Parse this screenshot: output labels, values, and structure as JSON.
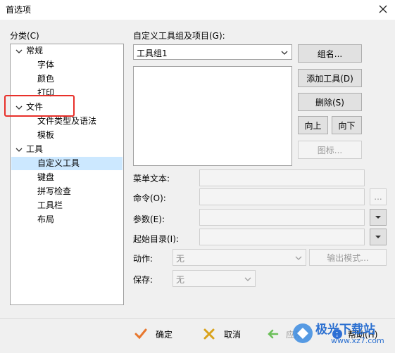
{
  "window": {
    "title": "首选项"
  },
  "category": {
    "label": "分类(C)",
    "items": [
      {
        "label": "常规"
      },
      {
        "label": "字体"
      },
      {
        "label": "颜色"
      },
      {
        "label": "打印"
      },
      {
        "label": "文件"
      },
      {
        "label": "文件类型及语法"
      },
      {
        "label": "模板"
      },
      {
        "label": "工具"
      },
      {
        "label": "自定义工具"
      },
      {
        "label": "键盘"
      },
      {
        "label": "拼写检查"
      },
      {
        "label": "工具栏"
      },
      {
        "label": "布局"
      }
    ]
  },
  "tools": {
    "group_label": "自定义工具组及项目(G):",
    "group_value": "工具组1",
    "buttons": {
      "group_name": "组名...",
      "add_tool": "添加工具(D)",
      "delete": "删除(S)",
      "up": "向上",
      "down": "向下",
      "icon": "图标..."
    },
    "fields": {
      "menu_text": "菜单文本:",
      "command": "命令(O):",
      "params": "参数(E):",
      "start_dir": "起始目录(I):",
      "action": "动作:",
      "action_value": "无",
      "output_mode": "输出模式...",
      "save": "保存:",
      "save_value": "无",
      "ellipsis": "..."
    }
  },
  "footer": {
    "ok": "确定",
    "cancel": "取消",
    "apply": "应用",
    "help": "帮助(H)"
  },
  "watermark": {
    "text": "极光下载站",
    "url_text": "www.xz7.com"
  },
  "colors": {
    "selection": "#cce8ff",
    "highlight_box": "#e8302a",
    "ok_check": "#e8772e",
    "cancel_x": "#d9a21b"
  }
}
